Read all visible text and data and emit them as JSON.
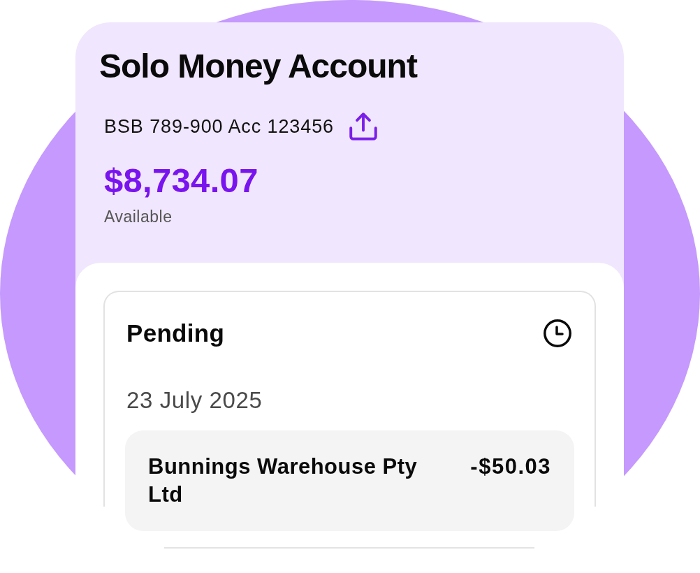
{
  "account": {
    "title": "Solo Money Account",
    "details": "BSB 789-900 Acc 123456",
    "balance": "$8,734.07",
    "balance_label": "Available"
  },
  "pending": {
    "title": "Pending",
    "groups": [
      {
        "date": "23 July 2025",
        "transactions": [
          {
            "name": "Bunnings Warehouse Pty Ltd",
            "amount": "-$50.03"
          }
        ]
      }
    ]
  }
}
